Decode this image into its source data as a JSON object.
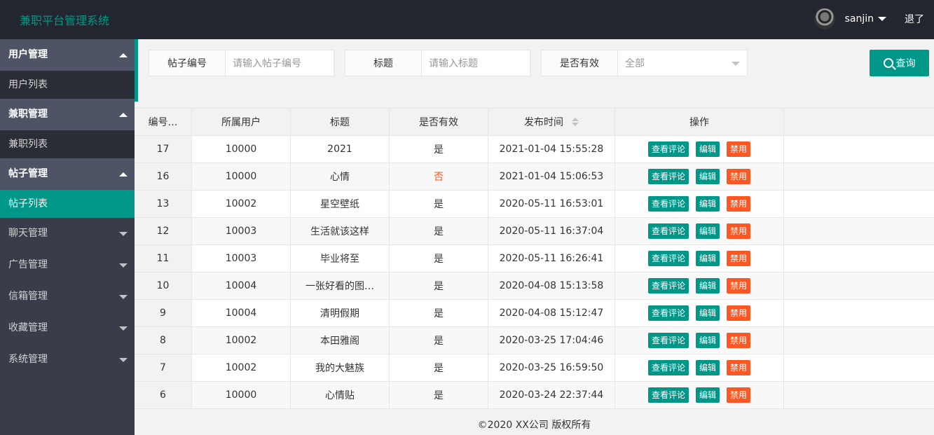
{
  "header": {
    "title": "兼职平台管理系统",
    "username": "sanjin",
    "logout": "退了"
  },
  "sidebar": {
    "groups": [
      {
        "label": "用户管理",
        "sub": "用户列表"
      },
      {
        "label": "兼职管理",
        "sub": "兼职列表"
      },
      {
        "label": "帖子管理",
        "sub": "帖子列表"
      }
    ],
    "closed": [
      "聊天管理",
      "广告管理",
      "信箱管理",
      "收藏管理",
      "系统管理"
    ]
  },
  "search": {
    "post_id_label": "帖子编号",
    "post_id_placeholder": "请输入帖子编号",
    "title_label": "标题",
    "title_placeholder": "请输入标题",
    "valid_label": "是否有效",
    "valid_value": "全部",
    "query_button": "查询"
  },
  "table": {
    "headers": [
      "编号…",
      "所属用户",
      "标题",
      "是否有效",
      "发布时间",
      "操作"
    ],
    "actions": {
      "view": "查看评论",
      "edit": "编辑",
      "ban": "禁用"
    },
    "rows": [
      {
        "id": "17",
        "user": "10000",
        "title": "2021",
        "valid": "是",
        "time": "2021-01-04 15:55:28"
      },
      {
        "id": "16",
        "user": "10000",
        "title": "心情",
        "valid": "否",
        "time": "2021-01-04 15:06:53"
      },
      {
        "id": "13",
        "user": "10002",
        "title": "星空壁纸",
        "valid": "是",
        "time": "2020-05-11 16:53:01"
      },
      {
        "id": "12",
        "user": "10003",
        "title": "生活就该这样",
        "valid": "是",
        "time": "2020-05-11 16:37:04"
      },
      {
        "id": "11",
        "user": "10003",
        "title": "毕业将至",
        "valid": "是",
        "time": "2020-05-11 16:26:41"
      },
      {
        "id": "10",
        "user": "10004",
        "title": "一张好看的图…",
        "valid": "是",
        "time": "2020-04-08 15:13:58"
      },
      {
        "id": "9",
        "user": "10004",
        "title": "清明假期",
        "valid": "是",
        "time": "2020-04-08 15:12:47"
      },
      {
        "id": "8",
        "user": "10002",
        "title": "本田雅阁",
        "valid": "是",
        "time": "2020-03-25 17:04:46"
      },
      {
        "id": "7",
        "user": "10002",
        "title": "我的大魅族",
        "valid": "是",
        "time": "2020-03-25 16:59:50"
      },
      {
        "id": "6",
        "user": "10000",
        "title": "心情贴",
        "valid": "是",
        "time": "2020-03-24 22:37:44"
      }
    ]
  },
  "footer": "©2020 XX公司 版权所有"
}
